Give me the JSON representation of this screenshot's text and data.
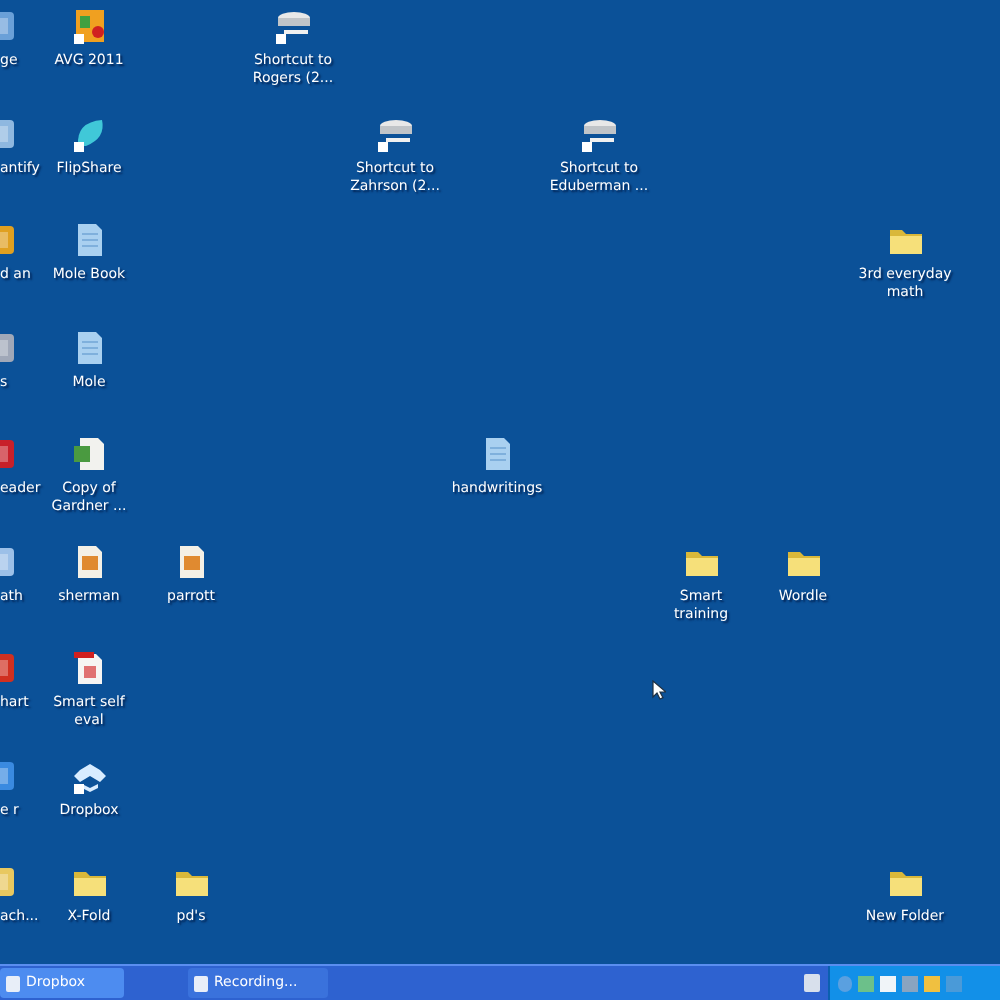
{
  "desktop": {
    "rows": [
      [
        {
          "label": "ge",
          "kind": "app",
          "color": "#6aa0d8"
        },
        {
          "label": "AVG 2011",
          "kind": "avg"
        },
        null,
        {
          "label": "Shortcut to Rogers (2...",
          "kind": "network-shortcut"
        },
        null,
        null,
        null,
        null,
        null,
        null
      ],
      [
        {
          "label": "antify",
          "kind": "app",
          "color": "#8fb8e0"
        },
        {
          "label": "FlipShare",
          "kind": "flipshare"
        },
        null,
        null,
        {
          "label": "Shortcut to Zahrson (2...",
          "kind": "network-shortcut"
        },
        null,
        {
          "label": "Shortcut to Eduberman ...",
          "kind": "network-shortcut"
        },
        null,
        null,
        null
      ],
      [
        {
          "label": "d an",
          "kind": "app",
          "color": "#e0a020"
        },
        {
          "label": "Mole Book",
          "kind": "file"
        },
        null,
        null,
        null,
        null,
        null,
        null,
        null,
        {
          "label": "3rd everyday math",
          "kind": "folder"
        }
      ],
      [
        {
          "label": "s",
          "kind": "app",
          "color": "#a0a8b8"
        },
        {
          "label": "Mole",
          "kind": "file"
        },
        null,
        null,
        null,
        null,
        null,
        null,
        null,
        null
      ],
      [
        {
          "label": "eader",
          "kind": "app",
          "color": "#c8202a"
        },
        {
          "label": "Copy of Gardner ...",
          "kind": "spreadsheet"
        },
        null,
        null,
        null,
        {
          "label": "handwritings",
          "kind": "file"
        },
        null,
        null,
        null,
        null
      ],
      [
        {
          "label": "ath",
          "kind": "app",
          "color": "#9cc0e8"
        },
        {
          "label": "sherman",
          "kind": "image"
        },
        {
          "label": "parrott",
          "kind": "image"
        },
        null,
        null,
        null,
        null,
        {
          "label": "Smart training",
          "kind": "folder"
        },
        {
          "label": "Wordle",
          "kind": "folder"
        },
        null
      ],
      [
        {
          "label": "hart",
          "kind": "app",
          "color": "#d03020"
        },
        {
          "label": "Smart self eval",
          "kind": "pdf"
        },
        null,
        null,
        null,
        null,
        null,
        null,
        null,
        null
      ],
      [
        {
          "label": "e r",
          "kind": "app",
          "color": "#3a8ae0"
        },
        {
          "label": "Dropbox",
          "kind": "dropbox"
        },
        null,
        null,
        null,
        null,
        null,
        null,
        null,
        null
      ],
      [
        {
          "label": "ach...",
          "kind": "app",
          "color": "#e8c860"
        },
        {
          "label": "X-Fold",
          "kind": "folder"
        },
        {
          "label": "pd's",
          "kind": "folder"
        },
        null,
        null,
        null,
        null,
        null,
        null,
        {
          "label": "New Folder",
          "kind": "folder"
        }
      ]
    ]
  },
  "taskbar": {
    "tasks": [
      {
        "label": "Dropbox",
        "selected": true
      },
      {
        "label": "Recording...",
        "selected": false
      }
    ]
  }
}
